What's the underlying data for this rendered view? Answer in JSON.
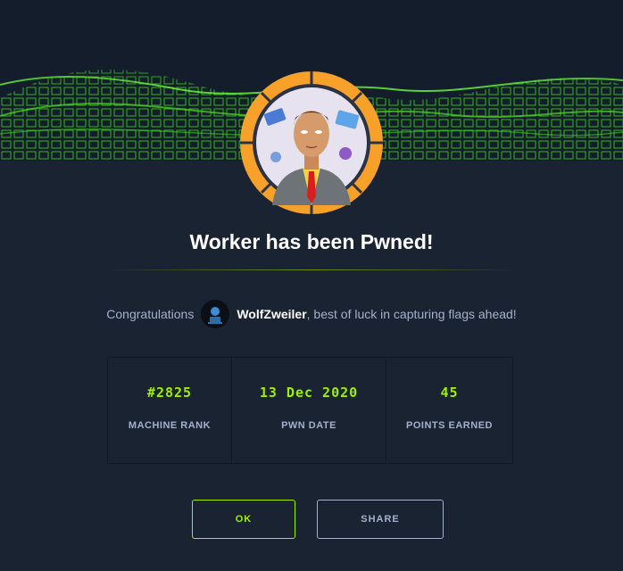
{
  "header": {
    "title": "Worker has been Pwned!"
  },
  "congrats": {
    "prefix": "Congratulations",
    "username": "WolfZweiler",
    "suffix": ", best of luck in capturing flags ahead!"
  },
  "stats": [
    {
      "value": "#2825",
      "label": "MACHINE RANK"
    },
    {
      "value": "13 Dec 2020",
      "label": "PWN DATE"
    },
    {
      "value": "45",
      "label": "POINTS EARNED"
    }
  ],
  "buttons": {
    "ok_label": "OK",
    "share_label": "SHARE"
  },
  "colors": {
    "background": "#1a2332",
    "accent": "#9fef00",
    "avatar_ring": "#f7a12b",
    "text_muted": "#a4b1cd"
  }
}
